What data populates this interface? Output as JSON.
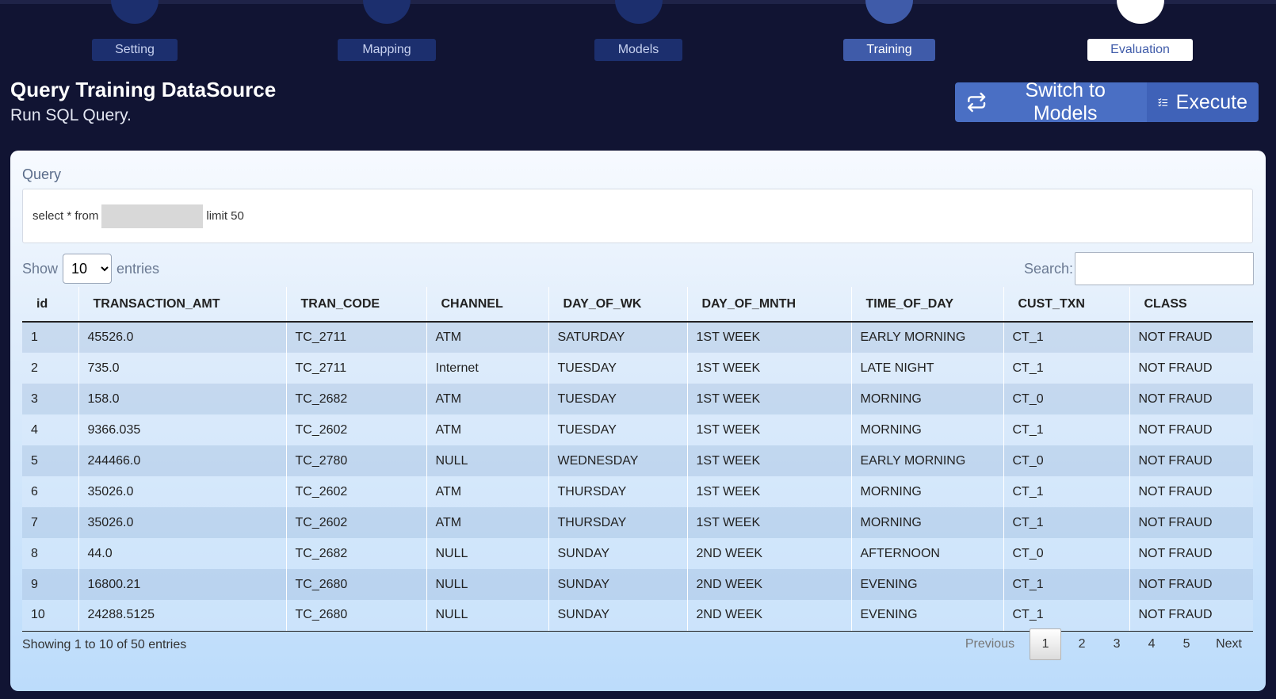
{
  "stepper": {
    "steps": [
      {
        "label": "Setting",
        "state": "done"
      },
      {
        "label": "Mapping",
        "state": "done"
      },
      {
        "label": "Models",
        "state": "done"
      },
      {
        "label": "Training",
        "state": "active"
      },
      {
        "label": "Evaluation",
        "state": "current"
      }
    ]
  },
  "header": {
    "title": "Query Training DataSource",
    "subtitle": "Run SQL Query.",
    "switch_label": "Switch to Models",
    "execute_label": "Execute"
  },
  "query": {
    "label": "Query",
    "prefix": "select * from",
    "suffix": "limit 50"
  },
  "controls": {
    "show_label": "Show",
    "page_size": "10",
    "entries_label": "entries",
    "search_label": "Search:"
  },
  "table": {
    "columns": [
      "id",
      "TRANSACTION_AMT",
      "TRAN_CODE",
      "CHANNEL",
      "DAY_OF_WK",
      "DAY_OF_MNTH",
      "TIME_OF_DAY",
      "CUST_TXN",
      "CLASS"
    ],
    "rows": [
      [
        "1",
        "45526.0",
        "TC_2711",
        "ATM",
        "SATURDAY",
        "1ST WEEK",
        "EARLY MORNING",
        "CT_1",
        "NOT FRAUD"
      ],
      [
        "2",
        "735.0",
        "TC_2711",
        "Internet",
        "TUESDAY",
        "1ST WEEK",
        "LATE NIGHT",
        "CT_1",
        "NOT FRAUD"
      ],
      [
        "3",
        "158.0",
        "TC_2682",
        "ATM",
        "TUESDAY",
        "1ST WEEK",
        "MORNING",
        "CT_0",
        "NOT FRAUD"
      ],
      [
        "4",
        "9366.035",
        "TC_2602",
        "ATM",
        "TUESDAY",
        "1ST WEEK",
        "MORNING",
        "CT_1",
        "NOT FRAUD"
      ],
      [
        "5",
        "244466.0",
        "TC_2780",
        "NULL",
        "WEDNESDAY",
        "1ST WEEK",
        "EARLY MORNING",
        "CT_0",
        "NOT FRAUD"
      ],
      [
        "6",
        "35026.0",
        "TC_2602",
        "ATM",
        "THURSDAY",
        "1ST WEEK",
        "MORNING",
        "CT_1",
        "NOT FRAUD"
      ],
      [
        "7",
        "35026.0",
        "TC_2602",
        "ATM",
        "THURSDAY",
        "1ST WEEK",
        "MORNING",
        "CT_1",
        "NOT FRAUD"
      ],
      [
        "8",
        "44.0",
        "TC_2682",
        "NULL",
        "SUNDAY",
        "2ND WEEK",
        "AFTERNOON",
        "CT_0",
        "NOT FRAUD"
      ],
      [
        "9",
        "16800.21",
        "TC_2680",
        "NULL",
        "SUNDAY",
        "2ND WEEK",
        "EVENING",
        "CT_1",
        "NOT FRAUD"
      ],
      [
        "10",
        "24288.5125",
        "TC_2680",
        "NULL",
        "SUNDAY",
        "2ND WEEK",
        "EVENING",
        "CT_1",
        "NOT FRAUD"
      ]
    ]
  },
  "footer": {
    "info": "Showing 1 to 10 of 50 entries",
    "previous": "Previous",
    "pages": [
      "1",
      "2",
      "3",
      "4",
      "5"
    ],
    "current_page": "1",
    "next": "Next"
  },
  "icons": {
    "switch": "arrows-repeat-icon",
    "execute": "list-checks-icon"
  },
  "colors": {
    "background": "#111433",
    "accent": "#4a6fc4",
    "step_done": "#1c2f6e",
    "step_active": "#3f5ba9"
  }
}
